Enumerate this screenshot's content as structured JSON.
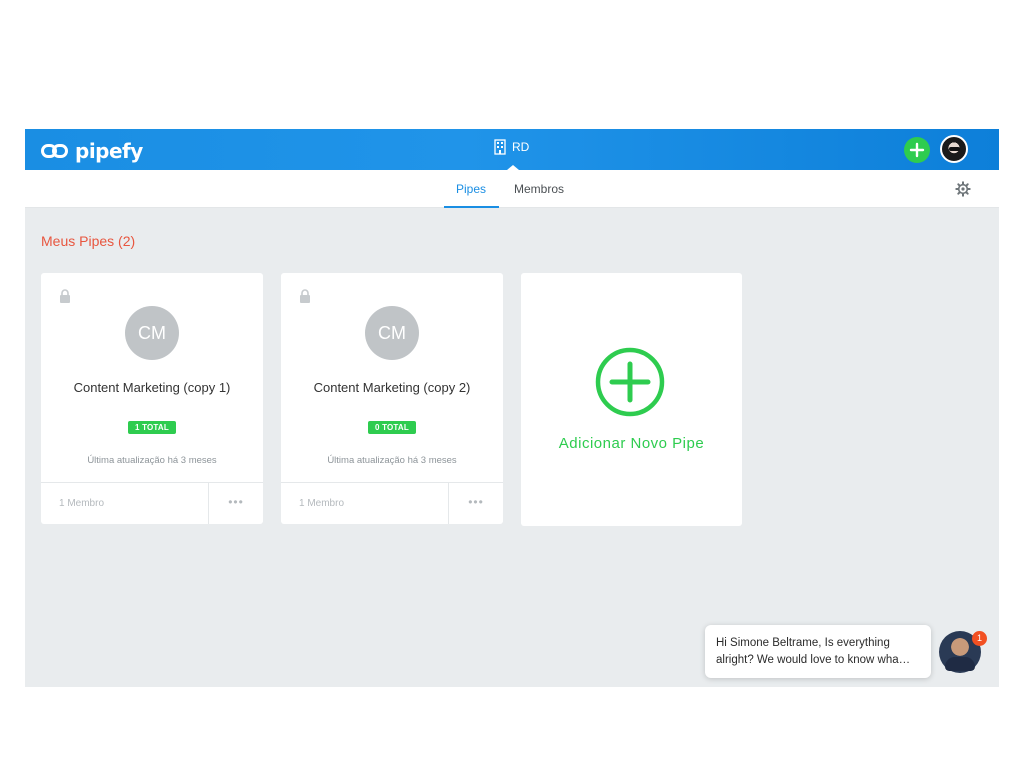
{
  "header": {
    "logo_text": "pipefy",
    "org_name": "RD"
  },
  "tabs": [
    {
      "label": "Pipes",
      "active": true
    },
    {
      "label": "Membros",
      "active": false
    }
  ],
  "section": {
    "title": "Meus Pipes (2)"
  },
  "pipes": [
    {
      "initials": "CM",
      "name": "Content Marketing (copy 1)",
      "badge": "1 TOTAL",
      "updated": "Última atualização há 3 meses",
      "members": "1 Membro",
      "more": "•••"
    },
    {
      "initials": "CM",
      "name": "Content Marketing (copy 2)",
      "badge": "0 TOTAL",
      "updated": "Última atualização há 3 meses",
      "members": "1 Membro",
      "more": "•••"
    }
  ],
  "add_pipe": {
    "label": "Adicionar Novo Pipe"
  },
  "chat": {
    "message": "Hi Simone Beltrame, Is everything alright? We would love to know wha…",
    "notification_count": "1"
  },
  "colors": {
    "header_blue": "#1a8ee3",
    "accent_green": "#2ecc4f",
    "section_red": "#e8563f",
    "background": "#e9ecee"
  },
  "icons": {
    "logo": "pipefy-logo-icon",
    "org": "building-icon",
    "add": "plus-icon",
    "settings": "gear-icon",
    "lock": "lock-icon"
  }
}
